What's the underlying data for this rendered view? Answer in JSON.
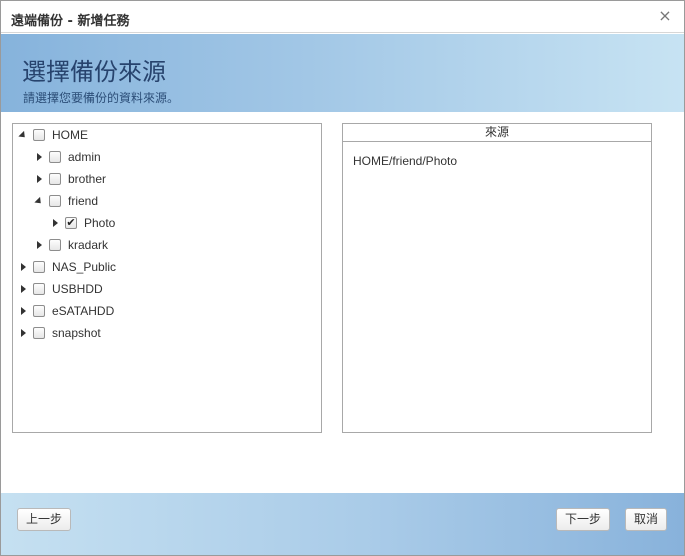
{
  "dialog": {
    "title": "遠端備份 - 新增任務",
    "close_glyph": "×"
  },
  "header": {
    "title": "選擇備份來源",
    "subtitle": "請選擇您要備份的資料來源。"
  },
  "tree": {
    "nodes": [
      {
        "label": "HOME",
        "expanded": true,
        "checked": false
      },
      {
        "label": "admin",
        "expanded": false,
        "checked": false
      },
      {
        "label": "brother",
        "expanded": false,
        "checked": false
      },
      {
        "label": "friend",
        "expanded": true,
        "checked": false
      },
      {
        "label": "Photo",
        "expanded": false,
        "checked": true
      },
      {
        "label": "kradark",
        "expanded": false,
        "checked": false
      },
      {
        "label": "NAS_Public",
        "expanded": false,
        "checked": false
      },
      {
        "label": "USBHDD",
        "expanded": false,
        "checked": false
      },
      {
        "label": "eSATAHDD",
        "expanded": false,
        "checked": false
      },
      {
        "label": "snapshot",
        "expanded": false,
        "checked": false
      }
    ],
    "check_glyph": "✔"
  },
  "source": {
    "header": "來源",
    "items": [
      "HOME/friend/Photo"
    ]
  },
  "footer": {
    "prev_label": "上一步",
    "next_label": "下一步",
    "cancel_label": "取消"
  },
  "colors": {
    "header_gradient_start": "#86b3dc",
    "header_gradient_end": "#c7e3f3",
    "header_title": "#27436d"
  }
}
